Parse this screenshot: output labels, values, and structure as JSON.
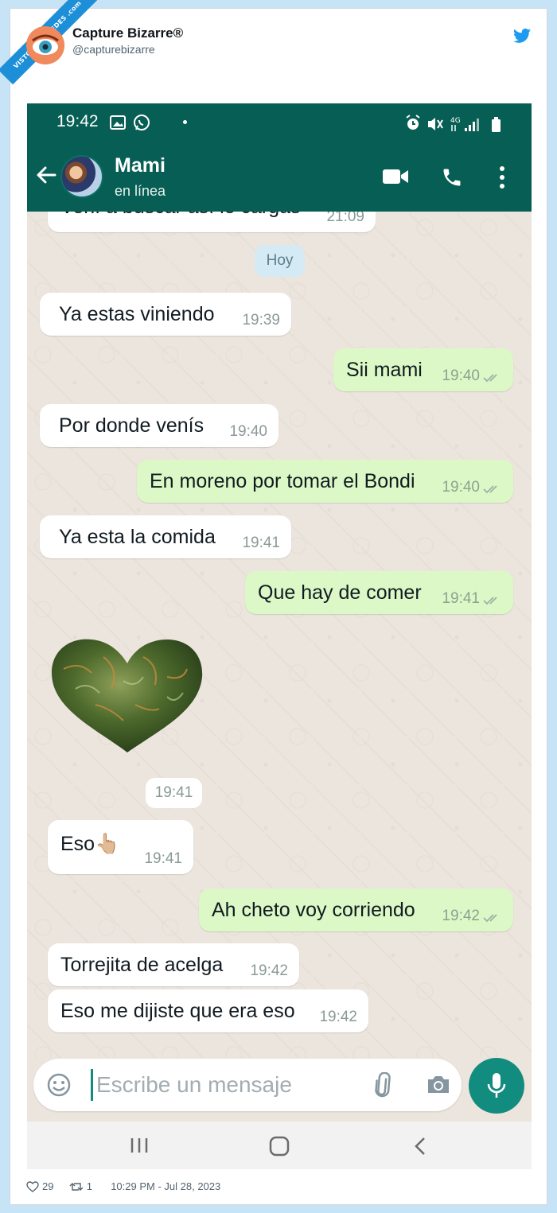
{
  "watermark": "VISTOENLASREDES .com",
  "tweet": {
    "name": "Capture Bizarre®",
    "handle": "@capturebizarre",
    "likes": "29",
    "retweets": "1",
    "timestamp": "10:29 PM - Jul 28, 2023"
  },
  "status_bar": {
    "time": "19:42",
    "network": "4G"
  },
  "chat_header": {
    "contact_name": "Mami",
    "contact_status": "en línea"
  },
  "messages": [
    {
      "dir": "in",
      "text": "Vení a buscar así le cargas",
      "time": "21:09"
    },
    {
      "dir": "in",
      "text": "Ya estas viniendo",
      "time": "19:39"
    },
    {
      "dir": "out",
      "text": "Sii mami",
      "time": "19:40"
    },
    {
      "dir": "in",
      "text": "Por donde venís",
      "time": "19:40"
    },
    {
      "dir": "out",
      "text": "En moreno por tomar el Bondi",
      "time": "19:40"
    },
    {
      "dir": "in",
      "text": "Ya esta la comida",
      "time": "19:41"
    },
    {
      "dir": "out",
      "text": "Que hay de comer",
      "time": "19:41"
    },
    {
      "dir": "in",
      "text": "Eso👆🏼",
      "time": "19:41"
    },
    {
      "dir": "out",
      "text": "Ah cheto voy corriendo",
      "time": "19:42"
    },
    {
      "dir": "in",
      "text": "Torrejita de acelga",
      "time": "19:42"
    },
    {
      "dir": "in",
      "text": "Eso me dijiste que era eso",
      "time": "19:42"
    }
  ],
  "day_divider": "Hoy",
  "image_message_time": "19:41",
  "composer": {
    "placeholder": "Escribe un mensaje"
  },
  "colors": {
    "whatsapp_green": "#075e54",
    "outgoing_bubble": "#dcf8c6",
    "incoming_bubble": "#ffffff",
    "accent": "#128c7e",
    "twitter_blue": "#1d9bf0"
  },
  "icons": [
    "gallery-icon",
    "whatsapp-icon",
    "alarm-icon",
    "mute-icon",
    "signal-icon",
    "battery-icon",
    "back-arrow-icon",
    "video-call-icon",
    "phone-call-icon",
    "more-options-icon",
    "emoji-icon",
    "attach-icon",
    "camera-icon",
    "mic-icon",
    "recent-apps-icon",
    "home-icon",
    "nav-back-icon",
    "twitter-bird-icon",
    "like-icon",
    "retweet-icon"
  ]
}
